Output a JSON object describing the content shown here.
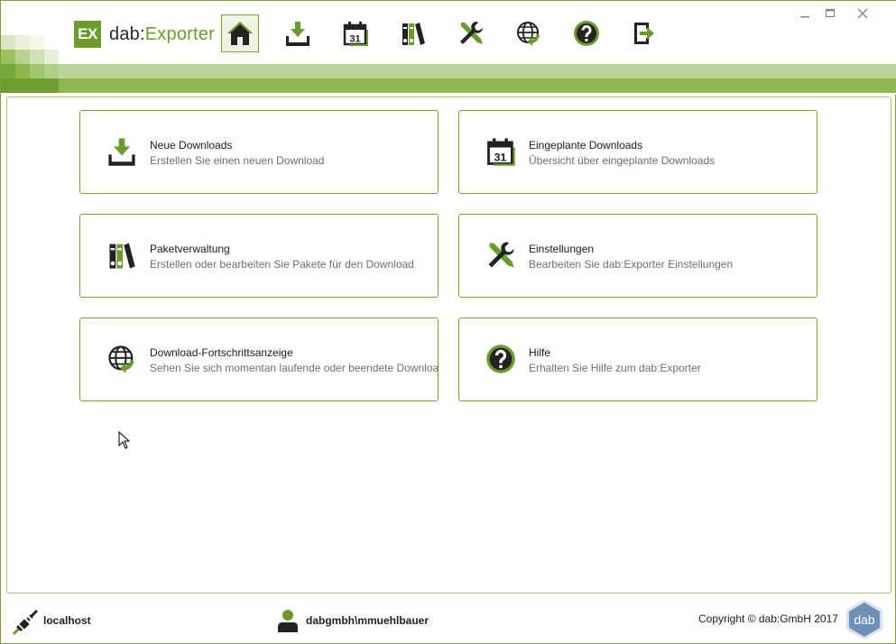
{
  "app": {
    "logo_badge": "EX",
    "logo_name": "dab",
    "logo_colon": ":",
    "logo_product": "Exporter"
  },
  "toolbar": {
    "items": [
      {
        "icon": "home-icon",
        "active": true
      },
      {
        "icon": "download-icon"
      },
      {
        "icon": "calendar-icon",
        "day": "31"
      },
      {
        "icon": "binders-icon"
      },
      {
        "icon": "tools-icon"
      },
      {
        "icon": "globe-icon"
      },
      {
        "icon": "help-icon"
      },
      {
        "icon": "exit-icon"
      }
    ]
  },
  "tiles": [
    {
      "title": "Neue Downloads",
      "description": "Erstellen Sie einen neuen Download",
      "icon": "download-icon"
    },
    {
      "title": "Eingeplante Downloads",
      "description": "Übersicht über eingeplante Downloads",
      "icon": "calendar-icon"
    },
    {
      "title": "Paketverwaltung",
      "description": "Erstellen oder bearbeiten Sie Pakete für den Download",
      "icon": "binders-icon"
    },
    {
      "title": "Einstellungen",
      "description": "Bearbeiten Sie dab:Exporter Einstellungen",
      "icon": "tools-icon"
    },
    {
      "title": "Download-Fortschrittsanzeige",
      "description": "Sehen Sie sich momentan laufende oder beendete Downloads an",
      "icon": "globe-icon"
    },
    {
      "title": "Hilfe",
      "description": "Erhalten Sie Hilfe zum dab:Exporter",
      "icon": "help-icon"
    }
  ],
  "status": {
    "server": "localhost",
    "user": "dabgmbh\\mmuehlbauer",
    "copyright": "Copyright © dab:GmbH 2017",
    "footer_logo": "dab"
  },
  "colors": {
    "accent": "#6a9c2c",
    "border": "#7aa33a",
    "stripe_light": "#bcd49a",
    "stripe_dark": "#8db84f"
  }
}
